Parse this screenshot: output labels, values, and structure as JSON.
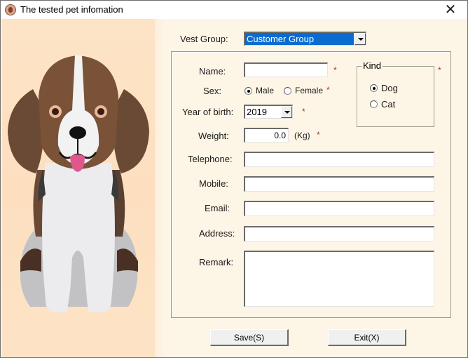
{
  "window": {
    "title": "The tested pet infomation",
    "icon": "dog-face-icon",
    "close_glyph": "✕"
  },
  "form": {
    "vest_group": {
      "label": "Vest Group:",
      "value": "Customer Group"
    },
    "name": {
      "label": "Name:",
      "value": "",
      "required_mark": "*"
    },
    "sex": {
      "label": "Sex:",
      "options": [
        {
          "label": "Male",
          "selected": true
        },
        {
          "label": "Female",
          "selected": false
        }
      ],
      "required_mark": "*"
    },
    "year_of_birth": {
      "label": "Year of birth:",
      "value": "2019",
      "required_mark": "*"
    },
    "weight": {
      "label": "Weight:",
      "value": "0.0",
      "unit": "(Kg)",
      "required_mark": "*"
    },
    "kind": {
      "legend": "Kind",
      "options": [
        {
          "label": "Dog",
          "selected": true
        },
        {
          "label": "Cat",
          "selected": false
        }
      ],
      "required_mark": "*"
    },
    "telephone": {
      "label": "Telephone:",
      "value": ""
    },
    "mobile": {
      "label": "Mobile:",
      "value": ""
    },
    "email": {
      "label": "Email:",
      "value": ""
    },
    "address": {
      "label": "Address:",
      "value": ""
    },
    "remark": {
      "label": "Remark:",
      "value": ""
    }
  },
  "buttons": {
    "save": "Save(S)",
    "exit": "Exit(X)"
  },
  "colors": {
    "accent_selection": "#0a6cd0",
    "required_mark": "#aa3333",
    "side_background": "#fde3c6",
    "form_background": "#fdf5e6"
  }
}
